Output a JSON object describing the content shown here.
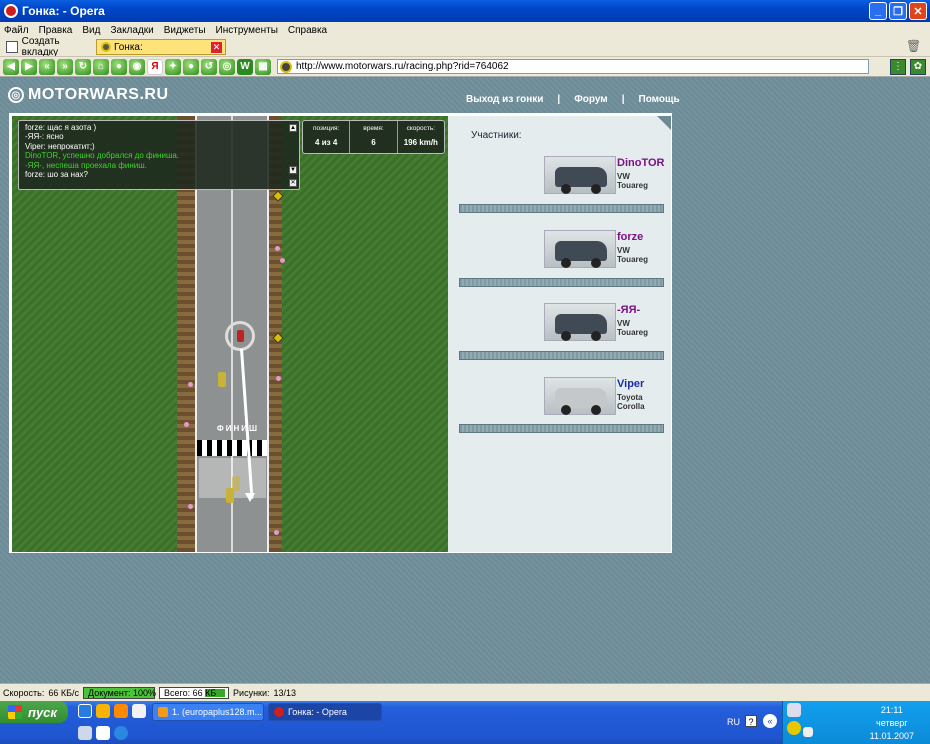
{
  "window": {
    "title": "Гонка: - Opera"
  },
  "menu": [
    "Файл",
    "Правка",
    "Вид",
    "Закладки",
    "Виджеты",
    "Инструменты",
    "Справка"
  ],
  "tabs": {
    "new_tab_label": "Создать вкладку",
    "active_tab_label": "Гонка:"
  },
  "address": {
    "url": "http://www.motorwars.ru/racing.php?rid=764062"
  },
  "site": {
    "logo": "MOTORWARS.RU",
    "links": {
      "exit": "Выход из гонки",
      "forum": "Форум",
      "help": "Помощь",
      "sep": "|"
    }
  },
  "chat": [
    {
      "text": "forze: щас я азота )",
      "system": false
    },
    {
      "text": "-ЯЯ-: ясно",
      "system": false
    },
    {
      "text": "Viper: непрокатит;)",
      "system": false
    },
    {
      "text": "DinoTOR, успешно добрался до финиша.",
      "system": true
    },
    {
      "text": "-ЯЯ-, неспеша проехала финиш.",
      "system": true
    },
    {
      "text": "forze: шо за нах?",
      "system": false
    }
  ],
  "stats": {
    "position": {
      "label": "позиция:",
      "value": "4 из 4"
    },
    "time": {
      "label": "время:",
      "value": "6"
    },
    "speed": {
      "label": "скорость:",
      "value": "196 km/h"
    }
  },
  "finish_label": "ФИНИШ",
  "participants": {
    "header": "Участники:",
    "list": [
      {
        "name": "DinoTOR",
        "car_make": "VW",
        "car_model": "Touareg",
        "name_color": "#7a1285",
        "car_color": "#3f4a55"
      },
      {
        "name": "forze",
        "car_make": "VW",
        "car_model": "Touareg",
        "name_color": "#7a1285",
        "car_color": "#3f4a55"
      },
      {
        "name": "-ЯЯ-",
        "car_make": "VW",
        "car_model": "Touareg",
        "name_color": "#7a1285",
        "car_color": "#3f4a55"
      },
      {
        "name": "Viper",
        "car_make": "Toyota",
        "car_model": "Corolla",
        "name_color": "#1a2fa5",
        "car_color": "#c4c8cb"
      }
    ]
  },
  "statusbar": {
    "speed_label": "Скорость:",
    "speed_value": "66 КБ/с",
    "document_label": "Документ:",
    "document_value": "100%",
    "document_progress": 1.0,
    "total_label": "Всего:",
    "total_value": "66 КБ",
    "images_label": "Рисунки:",
    "images_value": "13/13"
  },
  "taskbar": {
    "start_label": "пуск",
    "tasks": [
      {
        "label": "1. (europaplus128.m..."
      },
      {
        "label": "Гонка: - Opera"
      }
    ],
    "lang": "RU",
    "time": "21:11",
    "weekday": "четверг",
    "date": "11.01.2007"
  }
}
